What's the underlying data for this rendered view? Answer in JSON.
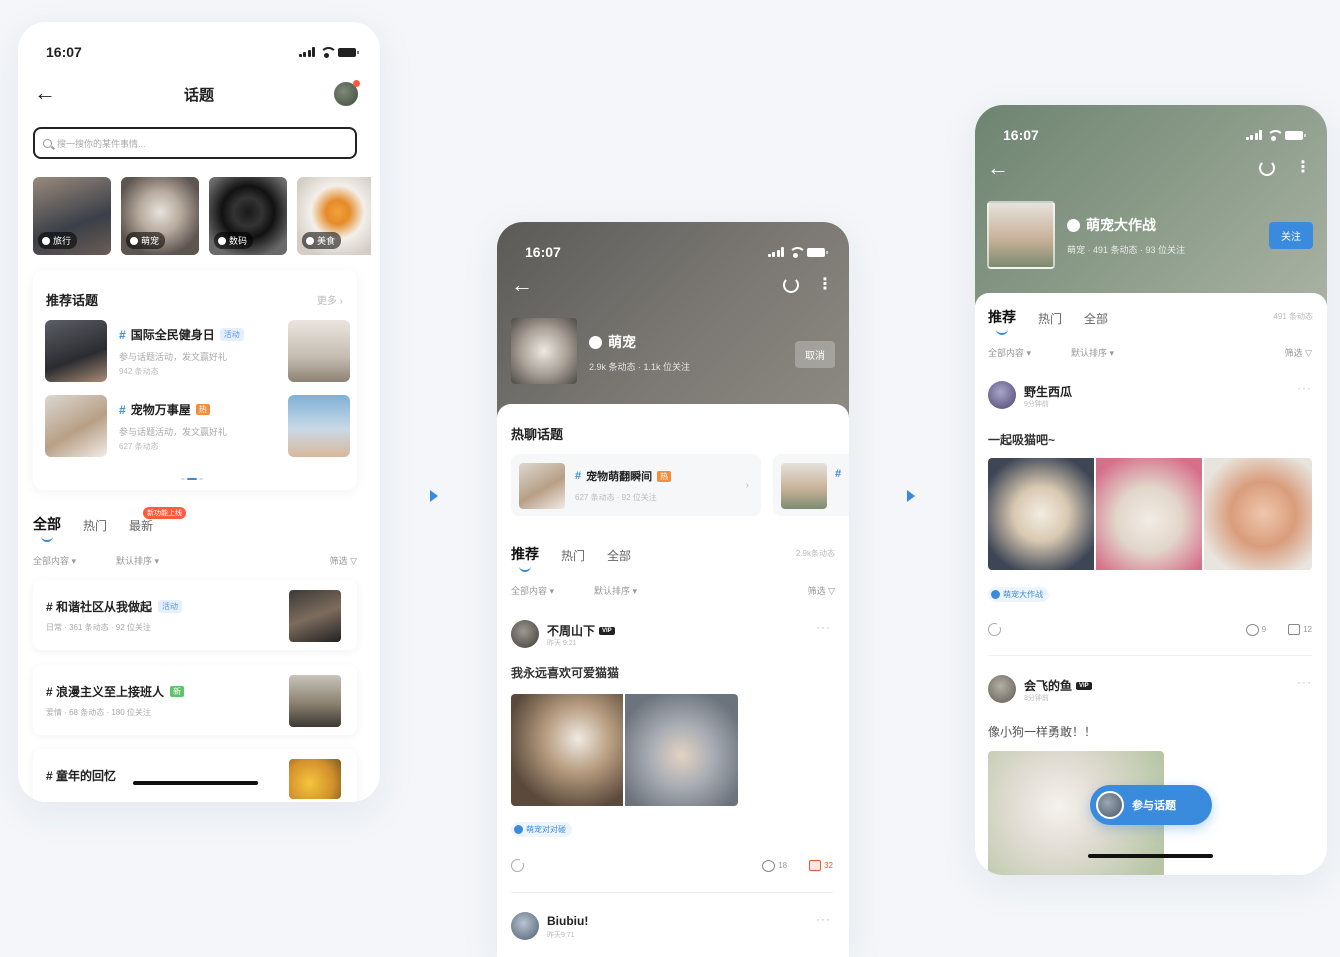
{
  "status_time": "16:07",
  "screen1": {
    "title": "话题",
    "search_placeholder": "搜一搜你的某件事情...",
    "categories": [
      "旅行",
      "萌宠",
      "数码",
      "美食"
    ],
    "recommend": {
      "title": "推荐话题",
      "more": "更多 ›",
      "topics": [
        {
          "name": "国际全民健身日",
          "tag": "活动",
          "desc": "参与话题活动，发文赢好礼",
          "count": "942 条动态"
        },
        {
          "name": "宠物万事屋",
          "tag": "热",
          "desc": "参与话题活动，发文赢好礼",
          "count": "627 条动态"
        }
      ]
    },
    "tabs": [
      "全部",
      "热门",
      "最新"
    ],
    "hot_badge": "新功能上线",
    "filters": {
      "content": "全部内容 ▾",
      "sort": "默认排序 ▾",
      "filter": "筛选 ▽"
    },
    "topic_list": [
      {
        "name": "# 和谐社区从我做起",
        "tag": "活动",
        "meta": "日常 · 361 条动态 · 92 位关注"
      },
      {
        "name": "# 浪漫主义至上接班人",
        "tag": "新",
        "meta": "爱情 · 68 条动态 · 180 位关注"
      },
      {
        "name": "# 童年的回忆",
        "tag": "",
        "meta": ""
      }
    ]
  },
  "screen2": {
    "topic_name": "萌宠",
    "meta": "2.9k 条动态 · 1.1k 位关注",
    "cancel_btn": "取消",
    "hot_title": "热聊话题",
    "hot_topic": {
      "name": "宠物萌翻瞬间",
      "tag": "热",
      "meta": "627 条动态 · 92 位关注"
    },
    "tabs": [
      "推荐",
      "热门",
      "全部"
    ],
    "count": "2.9k条动态",
    "filters": {
      "content": "全部内容 ▾",
      "sort": "默认排序 ▾",
      "filter": "筛选 ▽"
    },
    "post1": {
      "user": "不周山下",
      "vip": "VIP",
      "time": "昨天 9:21",
      "text": "我永远喜欢可爱猫猫",
      "topic": "萌宠对对碰",
      "comments": "18",
      "likes": "32"
    },
    "post2": {
      "user": "Biubiu!",
      "time": "昨天9:71"
    }
  },
  "screen3": {
    "topic_name": "萌宠大作战",
    "meta": "萌宠 · 491 条动态 · 93 位关注",
    "follow_btn": "关注",
    "tabs": [
      "推荐",
      "热门",
      "全部"
    ],
    "count": "491 条动态",
    "filters": {
      "content": "全部内容 ▾",
      "sort": "默认排序 ▾",
      "filter": "筛选 ▽"
    },
    "post1": {
      "user": "野生西瓜",
      "time": "9分钟前",
      "text": "一起吸猫吧~",
      "topic": "萌宠大作战",
      "comments": "9",
      "likes": "12"
    },
    "post2": {
      "user": "会飞的鱼",
      "vip": "VIP",
      "time": "3分钟前",
      "text": "像小狗一样勇敢！！"
    },
    "join_btn": "参与话题"
  }
}
